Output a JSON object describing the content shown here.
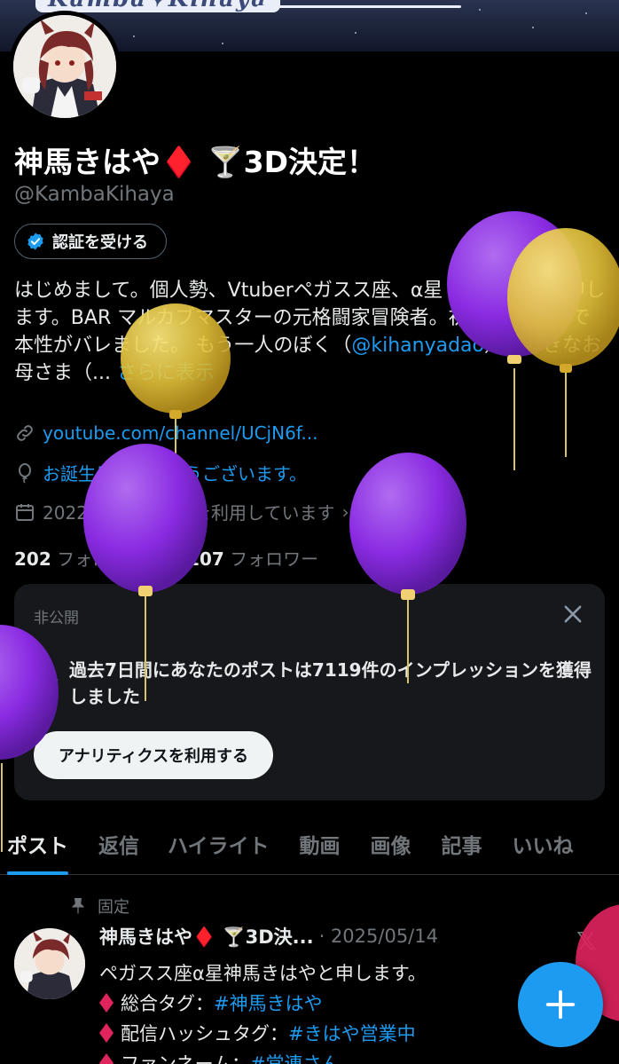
{
  "banner": {
    "text": "Kamba✦Kihaya"
  },
  "profile": {
    "display_name": "神馬きはや♦️ 🍸3D決定！",
    "handle": "@KambaKihaya",
    "verify_button": "認証を受ける",
    "bio_part1": "はじめまして。個人勢、Vtuberペガスス座、α星 神馬きはやと申します。BAR マルカブマスターの元格闘家冒険者。初配信後30分で本性がバレました。 もう一人のぼく（",
    "bio_mention": "@kihanyadao",
    "bio_part2": "）大好きなお母さま（...",
    "bio_more": " さらに表示",
    "link": "youtube.com/channel/UCjN6f...",
    "birthday": "お誕生日おめでとうございます。",
    "joined": "2022年10月からXを利用しています",
    "following_count": "202",
    "following_label": "フォロー中",
    "followers_count": "1,107",
    "followers_label": "フォロワー"
  },
  "analytics_card": {
    "label": "非公開",
    "text": "過去7日間にあなたのポストは7119件のインプレッションを獲得しました",
    "button": "アナリティクスを利用する"
  },
  "tabs": [
    "ポスト",
    "返信",
    "ハイライト",
    "動画",
    "画像",
    "記事",
    "いいね"
  ],
  "post": {
    "pinned_label": "固定",
    "name": "神馬きはや♦️ 🍸3D決...",
    "date": "· 2025/05/14",
    "line1": "ペガスス座α星神馬きはやと申します。",
    "line2_label": "総合タグ：",
    "line2_tag": "#神馬きはや",
    "line3_label": "配信ハッシュタグ：",
    "line3_tag": "#きはや営業中",
    "line4_label": "ファンネーム：",
    "line4_tag": "#常連さん"
  },
  "colors": {
    "accent": "#1d9bf0",
    "balloon_purple": "#8a2be2",
    "balloon_yellow": "#e3c23a"
  },
  "icons": [
    "verified-badge-icon",
    "link-icon",
    "balloon-icon",
    "calendar-icon",
    "close-icon",
    "pin-icon",
    "x-logo-icon",
    "plus-icon"
  ]
}
